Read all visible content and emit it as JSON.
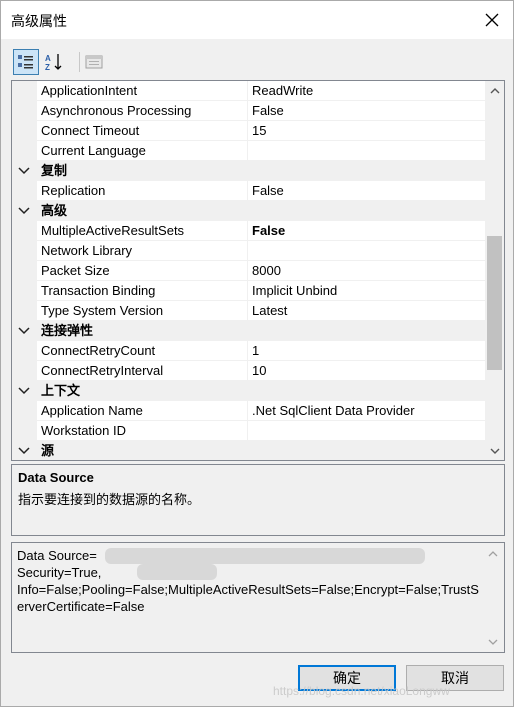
{
  "window": {
    "title": "高级属性"
  },
  "toolbar": {
    "categorized_icon": "categorized-view-icon",
    "alphabetical_icon": "alphabetical-sort-icon",
    "property_pages_icon": "property-pages-icon"
  },
  "grid": {
    "rows": [
      {
        "type": "prop",
        "name": "ApplicationIntent",
        "value": "ReadWrite"
      },
      {
        "type": "prop",
        "name": "Asynchronous Processing",
        "value": "False"
      },
      {
        "type": "prop",
        "name": "Connect Timeout",
        "value": "15"
      },
      {
        "type": "prop",
        "name": "Current Language",
        "value": ""
      },
      {
        "type": "cat",
        "name": "复制"
      },
      {
        "type": "prop",
        "name": "Replication",
        "value": "False"
      },
      {
        "type": "cat",
        "name": "高级"
      },
      {
        "type": "prop",
        "name": "MultipleActiveResultSets",
        "value": "False",
        "bold": true
      },
      {
        "type": "prop",
        "name": "Network Library",
        "value": ""
      },
      {
        "type": "prop",
        "name": "Packet Size",
        "value": "8000"
      },
      {
        "type": "prop",
        "name": "Transaction Binding",
        "value": "Implicit Unbind"
      },
      {
        "type": "prop",
        "name": "Type System Version",
        "value": "Latest"
      },
      {
        "type": "cat",
        "name": "连接弹性"
      },
      {
        "type": "prop",
        "name": "ConnectRetryCount",
        "value": "1"
      },
      {
        "type": "prop",
        "name": "ConnectRetryInterval",
        "value": "10"
      },
      {
        "type": "cat",
        "name": "上下文"
      },
      {
        "type": "prop",
        "name": "Application Name",
        "value": ".Net SqlClient Data Provider"
      },
      {
        "type": "prop",
        "name": "Workstation ID",
        "value": ""
      },
      {
        "type": "cat",
        "name": "源"
      }
    ]
  },
  "description": {
    "title": "Data Source",
    "text": "指示要连接到的数据源的名称。"
  },
  "connection_string": {
    "line1": "Data Source=",
    "line2": "Security=True,",
    "rest": "Info=False;Pooling=False;MultipleActiveResultSets=False;Encrypt=False;TrustServerCertificate=False"
  },
  "buttons": {
    "ok": "确定",
    "cancel": "取消"
  },
  "watermark": "https://blog.csdn.net/xiaoLongww"
}
